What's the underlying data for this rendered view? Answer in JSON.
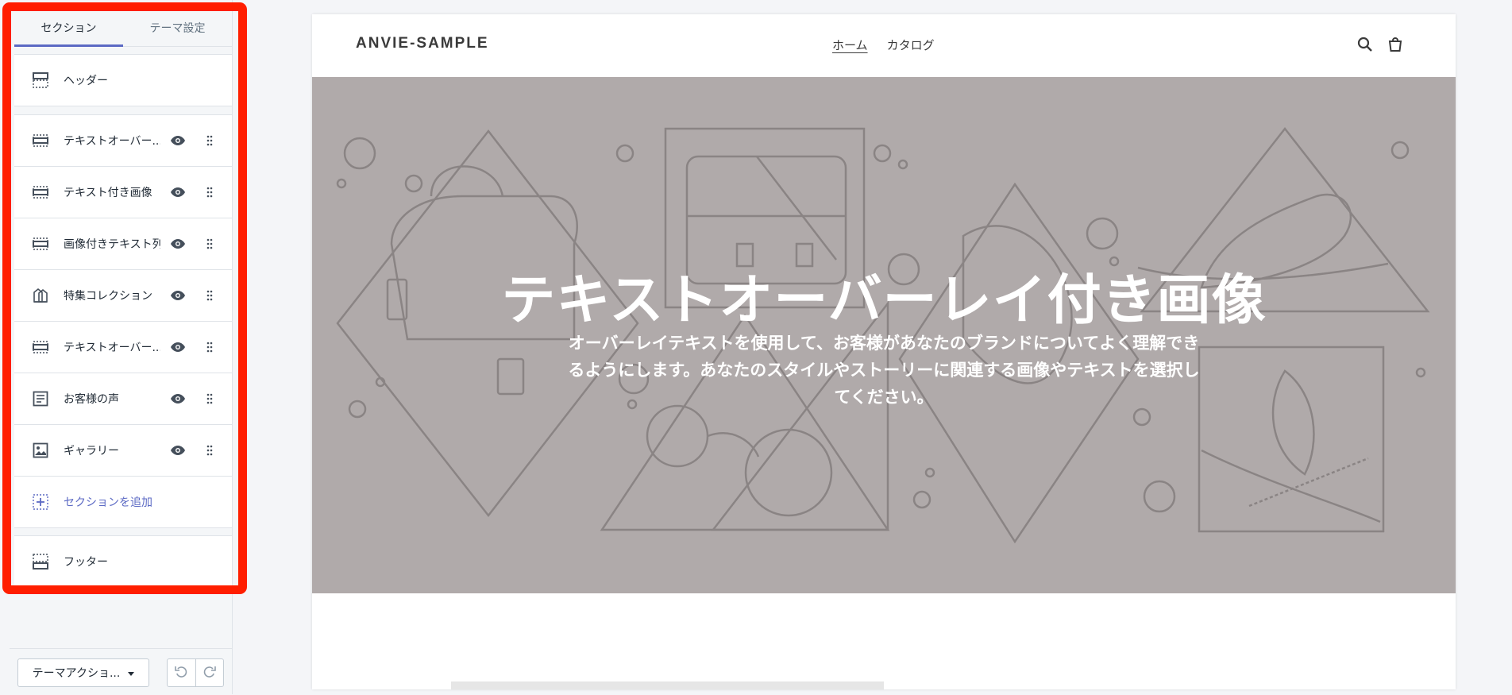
{
  "sidebar": {
    "tabs": [
      {
        "label": "セクション",
        "active": true
      },
      {
        "label": "テーマ設定",
        "active": false
      }
    ],
    "header_item": {
      "label": "ヘッダー",
      "icon": "header-layout-icon"
    },
    "sections": [
      {
        "label": "テキストオーバー...",
        "icon": "section-layout-icon"
      },
      {
        "label": "テキスト付き画像",
        "icon": "section-layout-icon"
      },
      {
        "label": "画像付きテキスト列",
        "icon": "section-layout-icon"
      },
      {
        "label": "特集コレクション",
        "icon": "collection-icon"
      },
      {
        "label": "テキストオーバー...",
        "icon": "section-layout-icon"
      },
      {
        "label": "お客様の声",
        "icon": "text-block-icon"
      },
      {
        "label": "ギャラリー",
        "icon": "image-icon"
      }
    ],
    "add_section": {
      "label": "セクションを追加",
      "icon": "add-section-icon"
    },
    "footer_item": {
      "label": "フッター",
      "icon": "footer-layout-icon"
    },
    "theme_actions_label": "テーマアクショ...",
    "undo_icon": "undo-icon",
    "redo_icon": "redo-icon"
  },
  "preview": {
    "logo": "ANVIE-SAMPLE",
    "nav": [
      {
        "label": "ホーム",
        "active": true
      },
      {
        "label": "カタログ",
        "active": false
      }
    ],
    "hero": {
      "title": "テキストオーバーレイ付き画像",
      "subtitle": "オーバーレイテキストを使用して、お客様があなたのブランドについてよく理解できるようにします。あなたのスタイルやストーリーに関連する画像やテキストを選択してください。"
    }
  },
  "colors": {
    "accent": "#5c6ac4",
    "highlight_frame": "#ff1e00",
    "hero_bg": "#b0aaaa"
  }
}
